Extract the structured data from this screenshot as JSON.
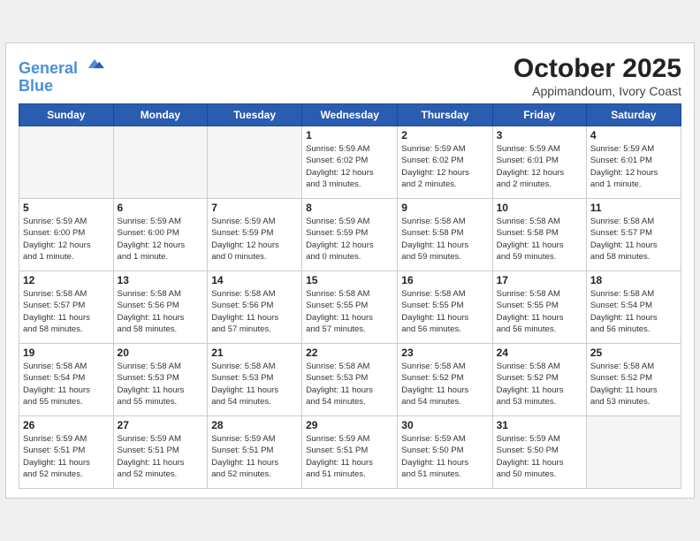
{
  "logo": {
    "line1": "General",
    "line2": "Blue"
  },
  "title": "October 2025",
  "location": "Appimandoum, Ivory Coast",
  "weekdays": [
    "Sunday",
    "Monday",
    "Tuesday",
    "Wednesday",
    "Thursday",
    "Friday",
    "Saturday"
  ],
  "weeks": [
    [
      {
        "day": "",
        "info": ""
      },
      {
        "day": "",
        "info": ""
      },
      {
        "day": "",
        "info": ""
      },
      {
        "day": "1",
        "info": "Sunrise: 5:59 AM\nSunset: 6:02 PM\nDaylight: 12 hours\nand 3 minutes."
      },
      {
        "day": "2",
        "info": "Sunrise: 5:59 AM\nSunset: 6:02 PM\nDaylight: 12 hours\nand 2 minutes."
      },
      {
        "day": "3",
        "info": "Sunrise: 5:59 AM\nSunset: 6:01 PM\nDaylight: 12 hours\nand 2 minutes."
      },
      {
        "day": "4",
        "info": "Sunrise: 5:59 AM\nSunset: 6:01 PM\nDaylight: 12 hours\nand 1 minute."
      }
    ],
    [
      {
        "day": "5",
        "info": "Sunrise: 5:59 AM\nSunset: 6:00 PM\nDaylight: 12 hours\nand 1 minute."
      },
      {
        "day": "6",
        "info": "Sunrise: 5:59 AM\nSunset: 6:00 PM\nDaylight: 12 hours\nand 1 minute."
      },
      {
        "day": "7",
        "info": "Sunrise: 5:59 AM\nSunset: 5:59 PM\nDaylight: 12 hours\nand 0 minutes."
      },
      {
        "day": "8",
        "info": "Sunrise: 5:59 AM\nSunset: 5:59 PM\nDaylight: 12 hours\nand 0 minutes."
      },
      {
        "day": "9",
        "info": "Sunrise: 5:58 AM\nSunset: 5:58 PM\nDaylight: 11 hours\nand 59 minutes."
      },
      {
        "day": "10",
        "info": "Sunrise: 5:58 AM\nSunset: 5:58 PM\nDaylight: 11 hours\nand 59 minutes."
      },
      {
        "day": "11",
        "info": "Sunrise: 5:58 AM\nSunset: 5:57 PM\nDaylight: 11 hours\nand 58 minutes."
      }
    ],
    [
      {
        "day": "12",
        "info": "Sunrise: 5:58 AM\nSunset: 5:57 PM\nDaylight: 11 hours\nand 58 minutes."
      },
      {
        "day": "13",
        "info": "Sunrise: 5:58 AM\nSunset: 5:56 PM\nDaylight: 11 hours\nand 58 minutes."
      },
      {
        "day": "14",
        "info": "Sunrise: 5:58 AM\nSunset: 5:56 PM\nDaylight: 11 hours\nand 57 minutes."
      },
      {
        "day": "15",
        "info": "Sunrise: 5:58 AM\nSunset: 5:55 PM\nDaylight: 11 hours\nand 57 minutes."
      },
      {
        "day": "16",
        "info": "Sunrise: 5:58 AM\nSunset: 5:55 PM\nDaylight: 11 hours\nand 56 minutes."
      },
      {
        "day": "17",
        "info": "Sunrise: 5:58 AM\nSunset: 5:55 PM\nDaylight: 11 hours\nand 56 minutes."
      },
      {
        "day": "18",
        "info": "Sunrise: 5:58 AM\nSunset: 5:54 PM\nDaylight: 11 hours\nand 56 minutes."
      }
    ],
    [
      {
        "day": "19",
        "info": "Sunrise: 5:58 AM\nSunset: 5:54 PM\nDaylight: 11 hours\nand 55 minutes."
      },
      {
        "day": "20",
        "info": "Sunrise: 5:58 AM\nSunset: 5:53 PM\nDaylight: 11 hours\nand 55 minutes."
      },
      {
        "day": "21",
        "info": "Sunrise: 5:58 AM\nSunset: 5:53 PM\nDaylight: 11 hours\nand 54 minutes."
      },
      {
        "day": "22",
        "info": "Sunrise: 5:58 AM\nSunset: 5:53 PM\nDaylight: 11 hours\nand 54 minutes."
      },
      {
        "day": "23",
        "info": "Sunrise: 5:58 AM\nSunset: 5:52 PM\nDaylight: 11 hours\nand 54 minutes."
      },
      {
        "day": "24",
        "info": "Sunrise: 5:58 AM\nSunset: 5:52 PM\nDaylight: 11 hours\nand 53 minutes."
      },
      {
        "day": "25",
        "info": "Sunrise: 5:58 AM\nSunset: 5:52 PM\nDaylight: 11 hours\nand 53 minutes."
      }
    ],
    [
      {
        "day": "26",
        "info": "Sunrise: 5:59 AM\nSunset: 5:51 PM\nDaylight: 11 hours\nand 52 minutes."
      },
      {
        "day": "27",
        "info": "Sunrise: 5:59 AM\nSunset: 5:51 PM\nDaylight: 11 hours\nand 52 minutes."
      },
      {
        "day": "28",
        "info": "Sunrise: 5:59 AM\nSunset: 5:51 PM\nDaylight: 11 hours\nand 52 minutes."
      },
      {
        "day": "29",
        "info": "Sunrise: 5:59 AM\nSunset: 5:51 PM\nDaylight: 11 hours\nand 51 minutes."
      },
      {
        "day": "30",
        "info": "Sunrise: 5:59 AM\nSunset: 5:50 PM\nDaylight: 11 hours\nand 51 minutes."
      },
      {
        "day": "31",
        "info": "Sunrise: 5:59 AM\nSunset: 5:50 PM\nDaylight: 11 hours\nand 50 minutes."
      },
      {
        "day": "",
        "info": ""
      }
    ]
  ]
}
